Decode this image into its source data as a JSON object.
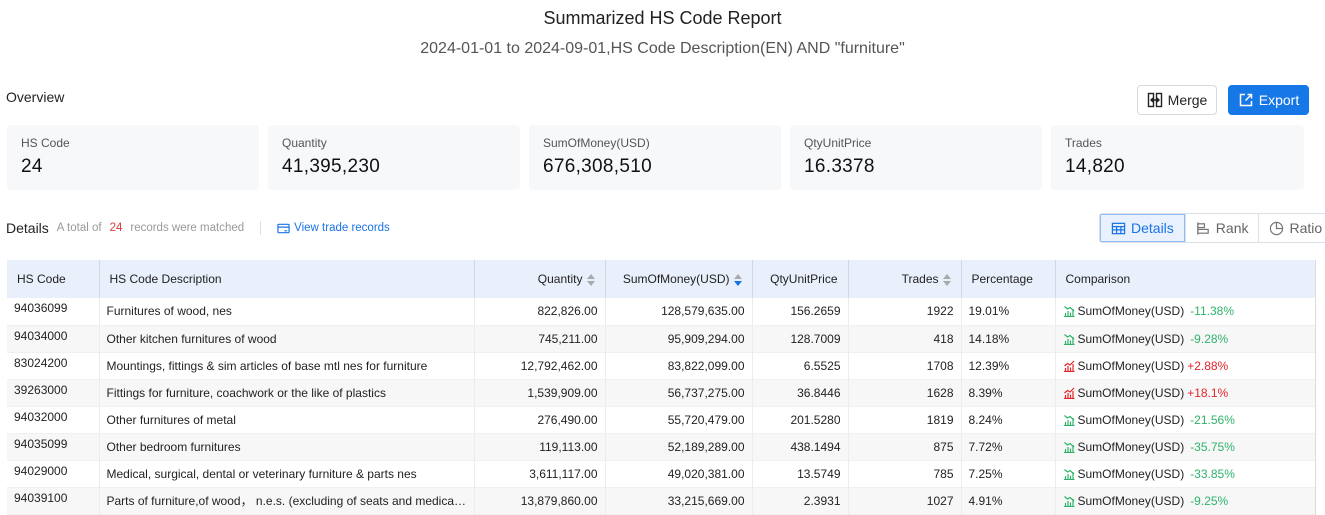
{
  "header": {
    "title": "Summarized HS Code Report",
    "subtitle": "2024-01-01 to 2024-09-01,HS Code Description(EN) AND \"furniture\""
  },
  "overview": {
    "label": "Overview",
    "merge_label": "Merge",
    "export_label": "Export",
    "cards": [
      {
        "label": "HS Code",
        "value": "24"
      },
      {
        "label": "Quantity",
        "value": "41,395,230"
      },
      {
        "label": "SumOfMoney(USD)",
        "value": "676,308,510"
      },
      {
        "label": "QtyUnitPrice",
        "value": "16.3378"
      },
      {
        "label": "Trades",
        "value": "14,820"
      }
    ]
  },
  "details": {
    "title": "Details",
    "note_prefix": "A total of",
    "count": "24",
    "note_suffix": "records were matched",
    "view_link": "View trade records",
    "views": [
      {
        "label": "Details",
        "icon": "table-icon",
        "active": true
      },
      {
        "label": "Rank",
        "icon": "bar-rank-icon",
        "active": false
      },
      {
        "label": "Ratio",
        "icon": "pie-chart-icon",
        "active": false
      }
    ]
  },
  "colors": {
    "accent": "#1677e6",
    "negative": "#2fb36b",
    "positive": "#e5252a",
    "count": "#e0393e"
  },
  "table": {
    "columns": [
      "HS Code",
      "HS Code Description",
      "Quantity",
      "SumOfMoney(USD)",
      "QtyUnitPrice",
      "Trades",
      "Percentage",
      "Comparison"
    ],
    "rows": [
      {
        "code": "94036099",
        "desc": "Furnitures of wood, nes",
        "qty": "822,826.00",
        "money": "128,579,635.00",
        "unit": "156.2659",
        "trades": "1922",
        "pct": "19.01%",
        "cmp_label": "SumOfMoney(USD)",
        "cmp_value": "-11.38%",
        "trend": "down"
      },
      {
        "code": "94034000",
        "desc": "Other kitchen furnitures of wood",
        "qty": "745,211.00",
        "money": "95,909,294.00",
        "unit": "128.7009",
        "trades": "418",
        "pct": "14.18%",
        "cmp_label": "SumOfMoney(USD)",
        "cmp_value": "-9.28%",
        "trend": "down"
      },
      {
        "code": "83024200",
        "desc": "Mountings, fittings & sim articles of base mtl nes for furniture",
        "qty": "12,792,462.00",
        "money": "83,822,099.00",
        "unit": "6.5525",
        "trades": "1708",
        "pct": "12.39%",
        "cmp_label": "SumOfMoney(USD)",
        "cmp_value": "+2.88%",
        "trend": "up"
      },
      {
        "code": "39263000",
        "desc": "Fittings for furniture, coachwork or the like of plastics",
        "qty": "1,539,909.00",
        "money": "56,737,275.00",
        "unit": "36.8446",
        "trades": "1628",
        "pct": "8.39%",
        "cmp_label": "SumOfMoney(USD)",
        "cmp_value": "+18.1%",
        "trend": "up"
      },
      {
        "code": "94032000",
        "desc": "Other furnitures of metal",
        "qty": "276,490.00",
        "money": "55,720,479.00",
        "unit": "201.5280",
        "trades": "1819",
        "pct": "8.24%",
        "cmp_label": "SumOfMoney(USD)",
        "cmp_value": "-21.56%",
        "trend": "down"
      },
      {
        "code": "94035099",
        "desc": "Other bedroom furnitures",
        "qty": "119,113.00",
        "money": "52,189,289.00",
        "unit": "438.1494",
        "trades": "875",
        "pct": "7.72%",
        "cmp_label": "SumOfMoney(USD)",
        "cmp_value": "-35.75%",
        "trend": "down"
      },
      {
        "code": "94029000",
        "desc": "Medical, surgical, dental or veterinary furniture & parts nes",
        "qty": "3,611,117.00",
        "money": "49,020,381.00",
        "unit": "13.5749",
        "trades": "785",
        "pct": "7.25%",
        "cmp_label": "SumOfMoney(USD)",
        "cmp_value": "-33.85%",
        "trend": "down"
      },
      {
        "code": "94039100",
        "desc": "Parts of furniture,of wood， n.e.s. (excluding of seats and medical, sur...",
        "qty": "13,879,860.00",
        "money": "33,215,669.00",
        "unit": "2.3931",
        "trades": "1027",
        "pct": "4.91%",
        "cmp_label": "SumOfMoney(USD)",
        "cmp_value": "-9.25%",
        "trend": "down"
      }
    ]
  }
}
